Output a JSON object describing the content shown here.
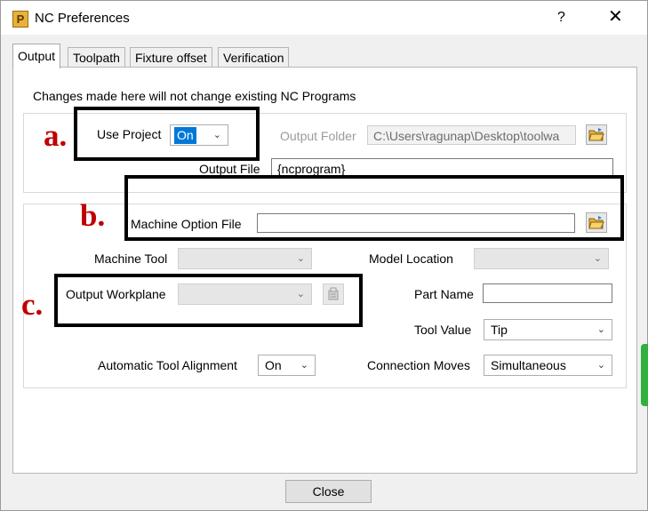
{
  "window": {
    "title": "NC Preferences",
    "help_label": "?",
    "close_label": "✕",
    "app_icon_letter": "P"
  },
  "tabs": [
    "Output",
    "Toolpath",
    "Fixture offset",
    "Verification"
  ],
  "notice": "Changes made here will not change existing NC Programs",
  "project": {
    "use_project_label": "Use Project",
    "use_project_value": "On",
    "output_folder_label": "Output Folder",
    "output_folder_value": "C:\\Users\\ragunap\\Desktop\\toolwa",
    "output_file_label": "Output File",
    "output_file_value": "{ncprogram}"
  },
  "machine": {
    "option_file_label": "Machine Option File",
    "option_file_value": "",
    "machine_tool_label": "Machine Tool",
    "machine_tool_value": "",
    "model_location_label": "Model Location",
    "model_location_value": "",
    "output_workplane_label": "Output Workplane",
    "output_workplane_value": "",
    "part_name_label": "Part Name",
    "part_name_value": "",
    "tool_value_label": "Tool Value",
    "tool_value_value": "Tip",
    "auto_align_label": "Automatic Tool Alignment",
    "auto_align_value": "On",
    "connection_moves_label": "Connection Moves",
    "connection_moves_value": "Simultaneous"
  },
  "annotations": [
    "a.",
    "b.",
    "c."
  ],
  "footer": {
    "close_label": "Close"
  },
  "colors": {
    "annotation": "#c00000",
    "selection": "#0078d7",
    "folder_icon": "#e8b23a"
  },
  "icons": {
    "folder": "folder-open-icon",
    "workplane": "workplane-icon",
    "app": "powermill-app-icon",
    "dropdown": "chevron-down-icon"
  }
}
